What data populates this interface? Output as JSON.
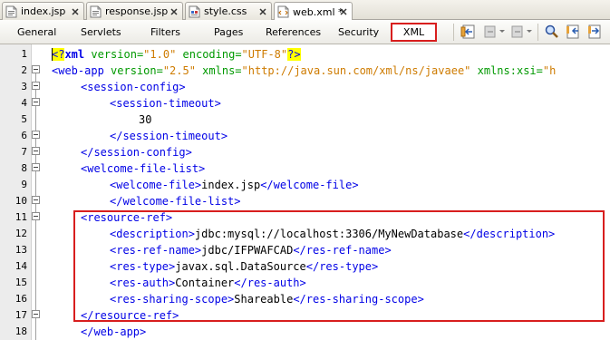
{
  "file_tabs": [
    {
      "label": "index.jsp",
      "icon": "jsp-file-icon"
    },
    {
      "label": "response.jsp",
      "icon": "jsp-file-icon"
    },
    {
      "label": "style.css",
      "icon": "css-file-icon"
    },
    {
      "label": "web.xml *",
      "icon": "xml-file-icon"
    }
  ],
  "view_tabs": {
    "general": "General",
    "servlets": "Servlets",
    "filters": "Filters",
    "pages": "Pages",
    "references": "References",
    "security": "Security",
    "xml": "XML"
  },
  "line_numbers": [
    "1",
    "2",
    "3",
    "4",
    "5",
    "6",
    "7",
    "8",
    "9",
    "10",
    "11",
    "12",
    "13",
    "14",
    "15",
    "16",
    "17",
    "18"
  ],
  "code": {
    "l1": {
      "open": "<?",
      "xml": "xml",
      "a1": " version=",
      "v1": "\"1.0\"",
      "a2": " encoding=",
      "v2": "\"UTF-8\"",
      "close": "?>"
    },
    "l2": {
      "tag": "<web-app",
      "a1": " version=",
      "v1": "\"2.5\"",
      "a2": " xmlns=",
      "v2": "\"http://java.sun.com/xml/ns/javaee\"",
      "a3": " xmlns:xsi=",
      "v3": "\"h"
    },
    "l3": "<session-config>",
    "l4": "<session-timeout>",
    "l5": "30",
    "l6": "</session-timeout>",
    "l7": "</session-config>",
    "l8": "<welcome-file-list>",
    "l9": {
      "open": "<welcome-file>",
      "text": "index.jsp",
      "close": "</welcome-file>"
    },
    "l10": "</welcome-file-list>",
    "l11": "<resource-ref>",
    "l12": {
      "open": "<description>",
      "text": "jdbc:mysql://localhost:3306/MyNewDatabase",
      "close": "</description>"
    },
    "l13": {
      "open": "<res-ref-name>",
      "text": "jdbc/IFPWAFCAD",
      "close": "</res-ref-name>"
    },
    "l14": {
      "open": "<res-type>",
      "text": "javax.sql.DataSource",
      "close": "</res-type>"
    },
    "l15": {
      "open": "<res-auth>",
      "text": "Container",
      "close": "</res-auth>"
    },
    "l16": {
      "open": "<res-sharing-scope>",
      "text": "Shareable",
      "close": "</res-sharing-scope>"
    },
    "l17": "</resource-ref>",
    "l18": "</web-app>"
  },
  "colors": {
    "tag": "#0000e6",
    "attribute": "#009900",
    "value": "#ce7b00",
    "highlight_box": "#d81e1e",
    "pi_highlight": "#ffff00"
  }
}
